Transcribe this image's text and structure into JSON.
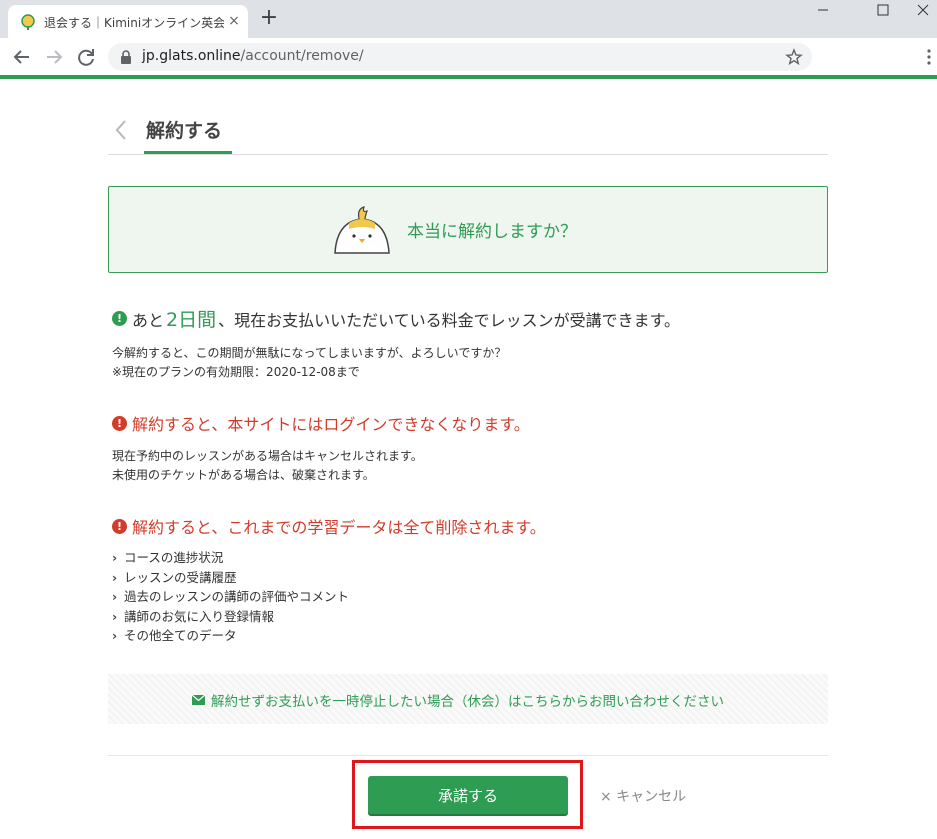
{
  "browser": {
    "tab_title": "退会する｜Kiminiオンライン英会話",
    "tab_close": "×",
    "new_tab": "+",
    "url_host": "jp.glats.online",
    "url_path": "/account/remove/"
  },
  "header": {
    "title": "解約する"
  },
  "confirm": {
    "text": "本当に解約しますか？"
  },
  "notice1": {
    "prefix": "あと",
    "days": "2日間",
    "suffix": "、現在お支払いいただいている料金でレッスンが受講できます。",
    "body_line1": "今解約すると、この期間が無駄になってしまいますが、よろしいですか？",
    "body_line2": "※現在のプランの有効期限：2020-12-08まで"
  },
  "notice2": {
    "heading": "解約すると、本サイトにはログインできなくなります。",
    "body_line1": "現在予約中のレッスンがある場合はキャンセルされます。",
    "body_line2": "未使用のチケットがある場合は、破棄されます。"
  },
  "notice3": {
    "heading": "解約すると、これまでの学習データは全て削除されます。",
    "items": [
      "コースの進捗状況",
      "レッスンの受講履歴",
      "過去のレッスンの講師の評価やコメント",
      "講師のお気に入り登録情報",
      "その他全てのデータ"
    ]
  },
  "pause": {
    "link_text": "解約せずお支払いを一時停止したい場合（休会）はこちらからお問い合わせください"
  },
  "actions": {
    "accept_label": "承諾する",
    "cancel_label": "× キャンセル"
  },
  "colors": {
    "accent": "#2e9d53",
    "warning": "#d23c2a",
    "highlight": "#e0161c"
  }
}
